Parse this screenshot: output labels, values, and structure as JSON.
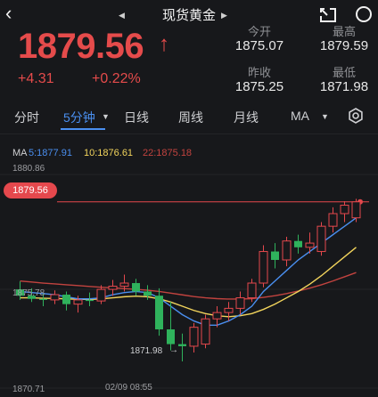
{
  "header": {
    "back_icon": "chevron-left-icon",
    "title": "现货黄金",
    "prev_icon": "triangle-left-icon",
    "next_icon": "triangle-right-icon",
    "expand_icon": "expand-arrow-icon",
    "search_icon": "search-icon"
  },
  "quote": {
    "price": "1879.56",
    "arrow": "↑",
    "change": "+4.31",
    "change_pct": "+0.22%",
    "open_label": "今开",
    "open": "1875.07",
    "high_label": "最高",
    "high": "1879.59",
    "prev_close_label": "昨收",
    "prev_close": "1875.25",
    "low_label": "最低",
    "low": "1871.98"
  },
  "tabs": {
    "items": [
      "分时",
      "5分钟",
      "日线",
      "周线",
      "月线",
      "MA"
    ],
    "active": "5分钟",
    "settings_icon": "gear-icon"
  },
  "ma_legend": {
    "label": "MA",
    "ma5": "5:1877.91",
    "ma10": "10:1876.61",
    "ma22": "22:1875.18"
  },
  "axis": {
    "top": "1880.86",
    "current": "1879.56",
    "mid": "1875.78",
    "low_marker": "1871.98",
    "bottom": "1870.71",
    "time": "02/09 08:55"
  },
  "colors": {
    "up": "#e5484d",
    "down": "#2fb25c",
    "ma5": "#4a8ff0",
    "ma10": "#f2d45c",
    "ma22": "#c2433f",
    "accent": "#4a8ff0"
  },
  "chart_data": {
    "type": "candlestick",
    "ylim": [
      1870.71,
      1880.86
    ],
    "candles": [
      {
        "o": 1875.4,
        "h": 1875.78,
        "l": 1874.9,
        "c": 1875.1
      },
      {
        "o": 1875.1,
        "h": 1875.45,
        "l": 1874.8,
        "c": 1874.95
      },
      {
        "o": 1874.95,
        "h": 1875.2,
        "l": 1874.6,
        "c": 1874.9
      },
      {
        "o": 1874.9,
        "h": 1875.35,
        "l": 1874.7,
        "c": 1875.15
      },
      {
        "o": 1875.15,
        "h": 1875.3,
        "l": 1874.4,
        "c": 1874.7
      },
      {
        "o": 1874.7,
        "h": 1875.1,
        "l": 1874.3,
        "c": 1874.9
      },
      {
        "o": 1874.9,
        "h": 1875.25,
        "l": 1874.6,
        "c": 1874.85
      },
      {
        "o": 1874.85,
        "h": 1875.6,
        "l": 1874.7,
        "c": 1875.4
      },
      {
        "o": 1875.4,
        "h": 1875.85,
        "l": 1875.1,
        "c": 1875.55
      },
      {
        "o": 1875.55,
        "h": 1876.1,
        "l": 1875.3,
        "c": 1875.7
      },
      {
        "o": 1875.7,
        "h": 1875.9,
        "l": 1875.1,
        "c": 1875.3
      },
      {
        "o": 1875.3,
        "h": 1875.6,
        "l": 1874.9,
        "c": 1875.1
      },
      {
        "o": 1875.1,
        "h": 1875.45,
        "l": 1873.2,
        "c": 1873.5
      },
      {
        "o": 1873.5,
        "h": 1874.8,
        "l": 1872.5,
        "c": 1872.8
      },
      {
        "o": 1872.8,
        "h": 1873.3,
        "l": 1871.98,
        "c": 1872.7
      },
      {
        "o": 1872.7,
        "h": 1873.8,
        "l": 1872.4,
        "c": 1873.6
      },
      {
        "o": 1872.8,
        "h": 1874.2,
        "l": 1872.6,
        "c": 1874.0
      },
      {
        "o": 1874.0,
        "h": 1874.6,
        "l": 1873.6,
        "c": 1874.3
      },
      {
        "o": 1874.3,
        "h": 1874.8,
        "l": 1873.9,
        "c": 1874.5
      },
      {
        "o": 1874.5,
        "h": 1875.3,
        "l": 1874.2,
        "c": 1875.0
      },
      {
        "o": 1875.0,
        "h": 1875.9,
        "l": 1874.8,
        "c": 1875.7
      },
      {
        "o": 1875.7,
        "h": 1877.5,
        "l": 1875.5,
        "c": 1877.2
      },
      {
        "o": 1877.2,
        "h": 1877.6,
        "l": 1876.4,
        "c": 1876.8
      },
      {
        "o": 1876.8,
        "h": 1877.9,
        "l": 1876.5,
        "c": 1877.7
      },
      {
        "o": 1877.7,
        "h": 1878.0,
        "l": 1877.1,
        "c": 1877.4
      },
      {
        "o": 1877.4,
        "h": 1878.1,
        "l": 1877.1,
        "c": 1877.6
      },
      {
        "o": 1877.2,
        "h": 1878.6,
        "l": 1877.0,
        "c": 1878.4
      },
      {
        "o": 1878.4,
        "h": 1879.3,
        "l": 1878.1,
        "c": 1879.0
      },
      {
        "o": 1879.0,
        "h": 1879.59,
        "l": 1878.6,
        "c": 1879.4
      },
      {
        "o": 1878.8,
        "h": 1879.7,
        "l": 1878.6,
        "c": 1879.56
      }
    ],
    "ma5": [
      1875.3,
      1875.25,
      1875.2,
      1875.15,
      1875.05,
      1874.95,
      1874.95,
      1875.0,
      1875.15,
      1875.25,
      1875.3,
      1875.25,
      1875.0,
      1874.6,
      1874.2,
      1873.9,
      1873.7,
      1873.7,
      1873.9,
      1874.2,
      1874.6,
      1875.3,
      1875.8,
      1876.3,
      1876.8,
      1877.2,
      1877.6,
      1878.0,
      1878.4,
      1878.8
    ],
    "ma10": [
      1875.0,
      1875.0,
      1874.98,
      1874.97,
      1874.95,
      1874.93,
      1874.92,
      1874.95,
      1875.0,
      1875.05,
      1875.08,
      1875.05,
      1874.95,
      1874.8,
      1874.6,
      1874.4,
      1874.25,
      1874.15,
      1874.1,
      1874.15,
      1874.25,
      1874.45,
      1874.7,
      1875.0,
      1875.3,
      1875.65,
      1876.05,
      1876.5,
      1876.95,
      1877.4
    ],
    "ma22": [
      1875.8,
      1875.75,
      1875.7,
      1875.66,
      1875.62,
      1875.58,
      1875.54,
      1875.5,
      1875.47,
      1875.44,
      1875.4,
      1875.36,
      1875.3,
      1875.22,
      1875.14,
      1875.06,
      1875.0,
      1874.96,
      1874.94,
      1874.94,
      1874.96,
      1875.02,
      1875.1,
      1875.2,
      1875.32,
      1875.46,
      1875.62,
      1875.8,
      1876.0,
      1876.2
    ]
  }
}
